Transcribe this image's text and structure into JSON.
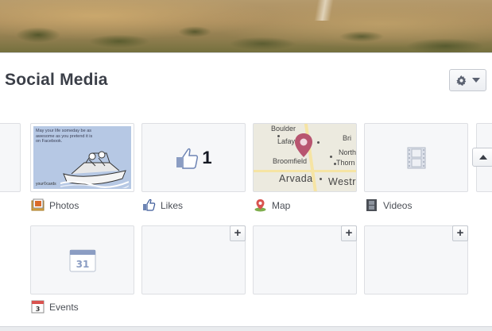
{
  "section": {
    "title": "Social Media"
  },
  "apps": [
    {
      "label": "Photos",
      "icon": "photos-icon"
    },
    {
      "label": "Likes",
      "icon": "likes-icon"
    },
    {
      "label": "Map",
      "icon": "map-icon"
    },
    {
      "label": "Videos",
      "icon": "videos-icon"
    },
    {
      "label": "Events",
      "icon": "events-icon"
    }
  ],
  "photo_preview": {
    "text": "May your life someday be as awesome as you pretend it is on Facebook.",
    "logo": "your©cards"
  },
  "likes_preview": {
    "count": "1"
  },
  "map_preview": {
    "places": [
      "Boulder",
      "Lafayette",
      "Bri",
      "North",
      "Broomfield",
      "Thorn",
      "Arvada",
      "Westr"
    ]
  },
  "calendar_preview": {
    "day": "31",
    "label_icon_day": "3"
  },
  "add_button_label": "+",
  "colors": {
    "page_background": "#e9ebee",
    "panel_background": "#ffffff",
    "tile_background": "#f6f7f9",
    "map_pin": "#b85570",
    "title_text": "#3b3f48"
  }
}
